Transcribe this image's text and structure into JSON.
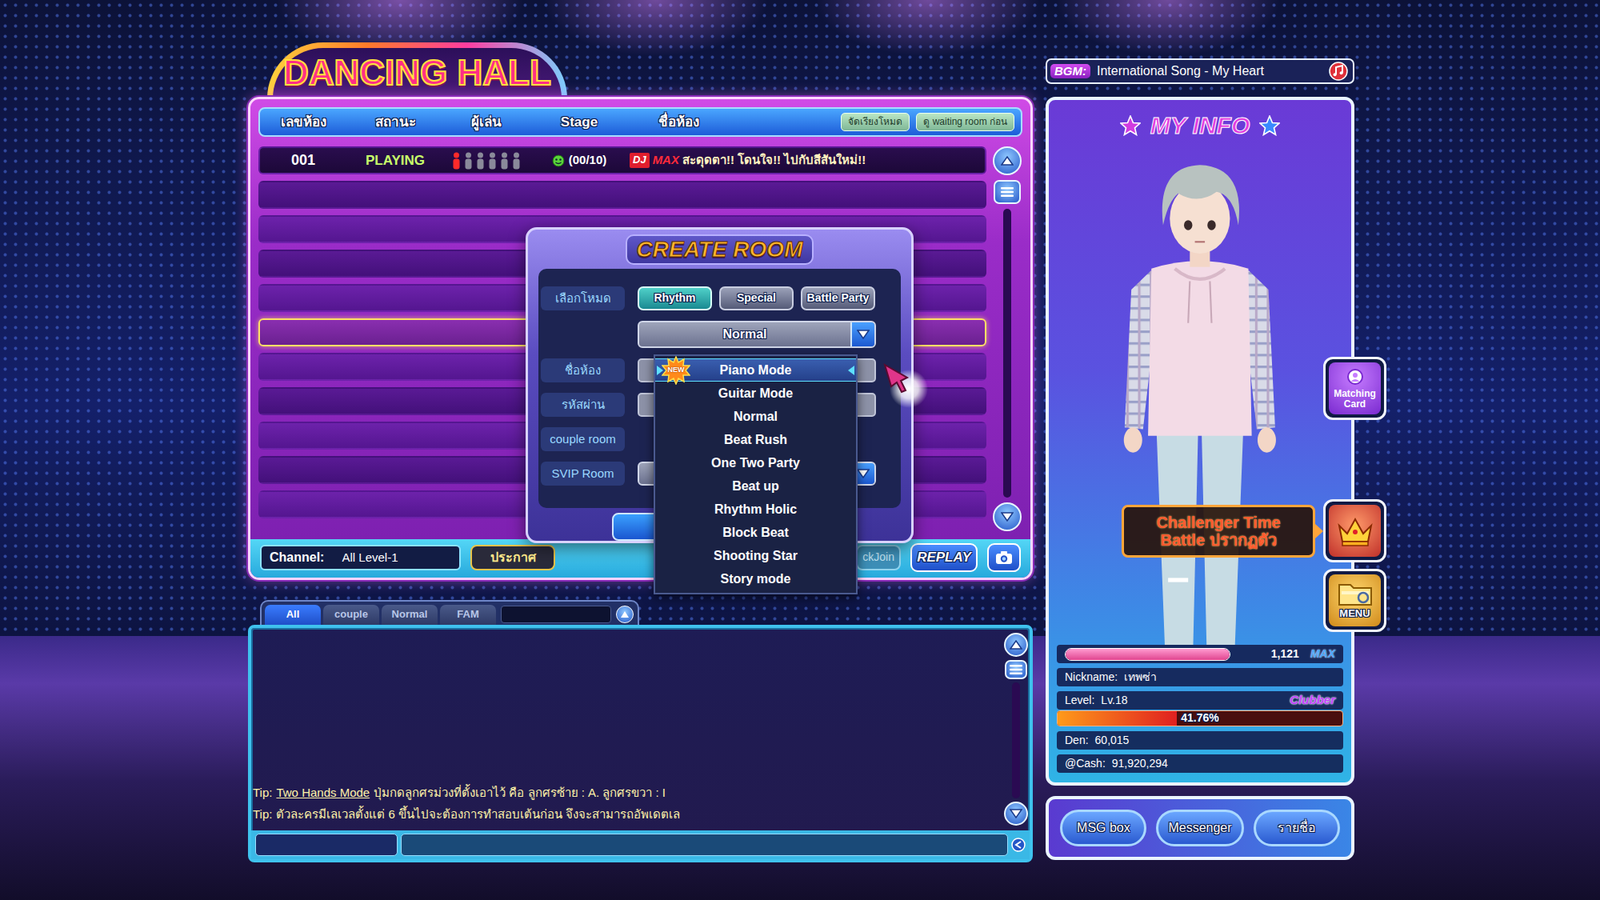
{
  "logo": {
    "text": "DANCING HALL"
  },
  "room_list": {
    "columns": [
      "เลขห้อง",
      "สถานะ",
      "ผู้เล่น",
      "Stage",
      "ชื่อห้อง"
    ],
    "header_buttons": [
      "จัดเรียงโหมด",
      "ดู waiting room ก่อน"
    ],
    "rows": [
      {
        "kind": "room",
        "selected": false,
        "number": "001",
        "status": "PLAYING",
        "slots": [
          true,
          false,
          false,
          false,
          false,
          false
        ],
        "count": "(00/10)",
        "dj": "DJ",
        "max": "MAX",
        "title": "สะดุดตา!! โดนใจ!! ไปกับสีสันใหม่!!"
      },
      {
        "kind": "empty",
        "selected": false
      },
      {
        "kind": "empty",
        "selected": false
      },
      {
        "kind": "empty",
        "selected": false
      },
      {
        "kind": "empty",
        "selected": false
      },
      {
        "kind": "empty",
        "selected": true
      },
      {
        "kind": "empty",
        "selected": false
      },
      {
        "kind": "empty",
        "selected": false
      },
      {
        "kind": "empty",
        "selected": false
      },
      {
        "kind": "empty",
        "selected": false
      },
      {
        "kind": "empty",
        "selected": false
      }
    ]
  },
  "channel_bar": {
    "label": "Channel:",
    "value": "All Level-1",
    "notice": "ประกาศ",
    "quick_join": "ckJoin",
    "replay": "REPLAY"
  },
  "create_room": {
    "title": "CREATE ROOM",
    "labels": [
      "เลือกโหมด",
      "ชื่อห้อง",
      "รหัสผ่าน",
      "couple room",
      "SVIP Room"
    ],
    "mode_tabs": [
      {
        "label": "Rhythm",
        "selected": true
      },
      {
        "label": "Special",
        "selected": false
      },
      {
        "label": "Battle Party",
        "selected": false
      }
    ],
    "submode": {
      "value": "Normal",
      "expanded": true,
      "options": [
        {
          "label": "Piano Mode",
          "selected": true,
          "badge": "NEW"
        },
        {
          "label": "Guitar Mode",
          "selected": false
        },
        {
          "label": "Normal",
          "selected": false
        },
        {
          "label": "Beat Rush",
          "selected": false
        },
        {
          "label": "One Two Party",
          "selected": false
        },
        {
          "label": "Beat up",
          "selected": false
        },
        {
          "label": "Rhythm Holic",
          "selected": false
        },
        {
          "label": "Block Beat",
          "selected": false
        },
        {
          "label": "Shooting Star",
          "selected": false
        },
        {
          "label": "Story mode",
          "selected": false
        }
      ]
    }
  },
  "chat": {
    "tabs": [
      {
        "label": "All",
        "selected": true
      },
      {
        "label": "couple",
        "selected": false
      },
      {
        "label": "Normal",
        "selected": false
      },
      {
        "label": "FAM",
        "selected": false
      }
    ],
    "lines": [
      {
        "label": "Tip:",
        "highlight": "Two Hands Mode",
        "text": "ปุ่มกดลูกศรม่วงที่ตั้งเอาไว้ คือ ลูกศรซ้าย : A. ลูกศรขวา : I"
      },
      {
        "label": "Tip:",
        "text": "ตัวละครมีเลเวลตั้งแต่ 6 ขึ้นไปจะต้องการทำสอบเต้นก่อน จึงจะสามารถอัพเดตเล"
      }
    ]
  },
  "bgm": {
    "label": "BGM:",
    "song": "International Song - My Heart"
  },
  "my_info": {
    "title": "MY INFO",
    "matching_card": "Matching Card",
    "callout": [
      "Challenger Time",
      "Battle ปรากฏตัว"
    ],
    "menu": "MENU",
    "fame": {
      "level": 1,
      "value": "1,121",
      "badge": "MAX"
    },
    "nickname": {
      "label": "Nickname:",
      "value": "เทพซ่า"
    },
    "player_level": {
      "label": "Level:",
      "value": "Lv.18",
      "rank": "Clubber"
    },
    "exp": {
      "level": 0.4176,
      "reading": "41.76%"
    },
    "den": {
      "label": "Den:",
      "value": "60,015"
    },
    "cash": {
      "label": "@Cash:",
      "value": "91,920,294"
    }
  },
  "bottom_buttons": [
    "MSG box",
    "Messenger",
    "รายชื่อ"
  ]
}
